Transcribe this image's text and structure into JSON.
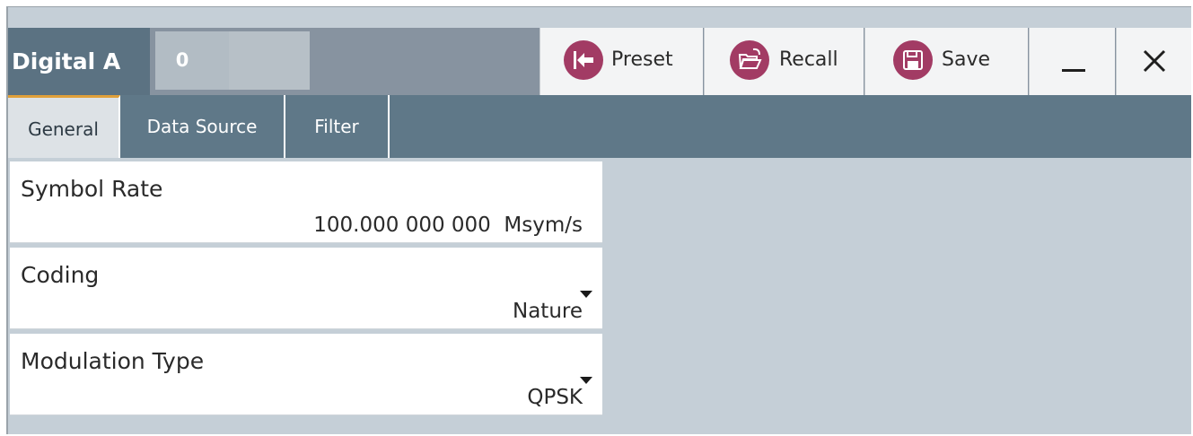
{
  "window": {
    "title": "Digital A",
    "indicator": "0",
    "buttons": {
      "preset": "Preset",
      "recall": "Recall",
      "save": "Save",
      "minimize": "_",
      "close": "✕"
    }
  },
  "tabs": [
    {
      "label": "General",
      "active": true
    },
    {
      "label": "Data Source",
      "active": false
    },
    {
      "label": "Filter",
      "active": false
    }
  ],
  "fields": {
    "symbol_rate": {
      "label": "Symbol Rate",
      "value": "100.000 000 000  Msym/s"
    },
    "coding": {
      "label": "Coding",
      "value": "Nature"
    },
    "modulation_type": {
      "label": "Modulation Type",
      "value": "QPSK"
    }
  },
  "colors": {
    "accent": "#a23b64",
    "title_bg": "#5b7282",
    "tab_bar": "#5f7888",
    "active_tab_marker": "#e0a03a"
  }
}
